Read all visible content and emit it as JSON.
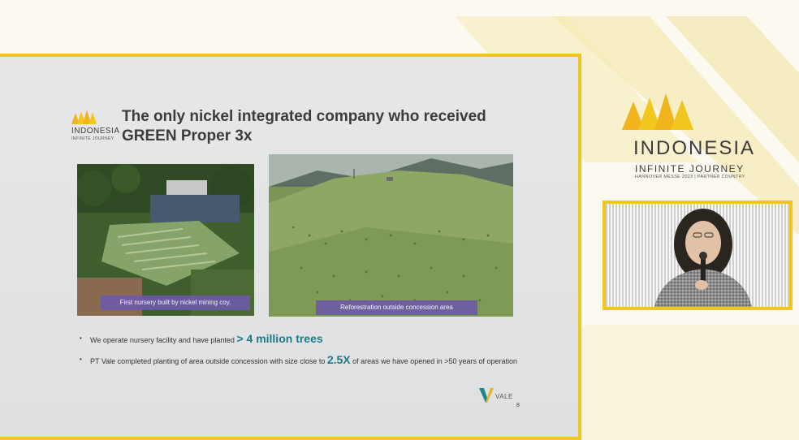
{
  "slide": {
    "logo_word": "INDONESIA",
    "logo_sub": "INFINITE JOURNEY",
    "title": "The only nickel integrated company who received GREEN Proper 3x",
    "photos": [
      {
        "caption": "First nursery built by nickel mining coy."
      },
      {
        "caption": "Reforestration outside concession area"
      }
    ],
    "bullets": [
      {
        "text_before": "We operate nursery facility and have planted ",
        "highlight": "> 4 million trees",
        "text_after": ""
      },
      {
        "text_before": "PT Vale completed planting of area outside concession with size close to ",
        "highlight": "2.5X",
        "text_after": " of areas we have opened in >50 years of operation"
      }
    ],
    "vale_logo_text": "VALE",
    "page_number": "8"
  },
  "branding": {
    "title": "INDONESIA",
    "tagline": "INFINITE JOURNEY",
    "event": "HANNOVER MESSE 2023 | PARTNER COUNTRY"
  },
  "colors": {
    "accent_yellow": "#f2c71d",
    "caption_purple": "#6d5aa8",
    "highlight_teal": "#1a7a8c"
  }
}
